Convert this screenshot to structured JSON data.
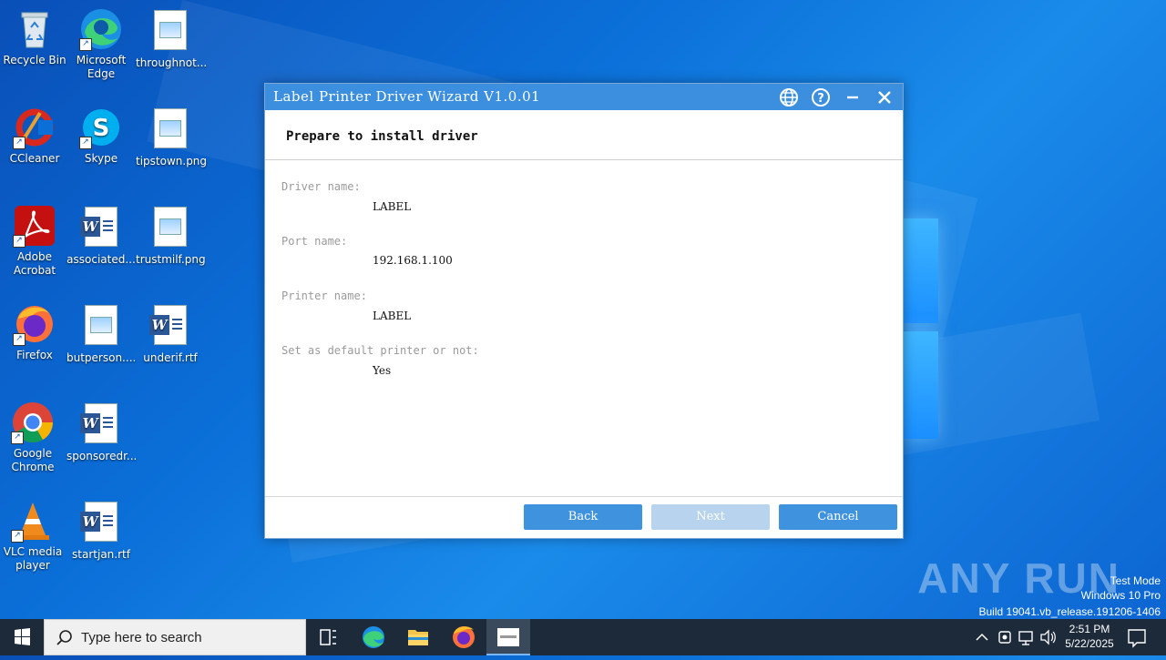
{
  "desktop": {
    "icons": [
      {
        "label": "Recycle Bin"
      },
      {
        "label": "Microsoft Edge"
      },
      {
        "label": "throughnot..."
      },
      {
        "label": "CCleaner"
      },
      {
        "label": "Skype"
      },
      {
        "label": "tipstown.png"
      },
      {
        "label": "Adobe Acrobat"
      },
      {
        "label": "associated..."
      },
      {
        "label": "trustmilf.png"
      },
      {
        "label": "Firefox"
      },
      {
        "label": "butperson...."
      },
      {
        "label": "underif.rtf"
      },
      {
        "label": "Google Chrome"
      },
      {
        "label": "sponsoredr..."
      },
      {
        "label": "VLC media player"
      },
      {
        "label": "startjan.rtf"
      }
    ]
  },
  "dialog": {
    "title": "Label Printer Driver Wizard  V1.0.01",
    "heading": "Prepare to install driver",
    "fields": [
      {
        "label": "Driver name:",
        "value": "LABEL"
      },
      {
        "label": "Port name:",
        "value": "192.168.1.100"
      },
      {
        "label": "Printer name:",
        "value": "LABEL"
      },
      {
        "label": "Set as default printer or not:",
        "value": "Yes"
      }
    ],
    "buttons": {
      "back": "Back",
      "next": "Next",
      "cancel": "Cancel"
    },
    "colors": {
      "accent": "#3b8fde",
      "button": "#3f93de",
      "disabled": "#b8d3ee"
    }
  },
  "watermark": {
    "brand": "ANY RUN",
    "line1": "Test Mode",
    "line2": "Windows 10 Pro",
    "line3": "Build 19041.vb_release.191206-1406"
  },
  "taskbar": {
    "search_placeholder": "Type here to search",
    "time": "2:51 PM",
    "date": "5/22/2025"
  }
}
